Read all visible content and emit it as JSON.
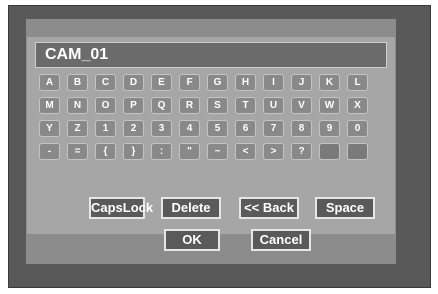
{
  "title": "CAM_01",
  "keyboard": {
    "rows": [
      [
        "A",
        "B",
        "C",
        "D",
        "E",
        "F",
        "G",
        "H",
        "I",
        "J",
        "K",
        "L"
      ],
      [
        "M",
        "N",
        "O",
        "P",
        "Q",
        "R",
        "S",
        "T",
        "U",
        "V",
        "W",
        "X"
      ],
      [
        "Y",
        "Z",
        "1",
        "2",
        "3",
        "4",
        "5",
        "6",
        "7",
        "8",
        "9",
        "0"
      ],
      [
        "-",
        "=",
        "{",
        "}",
        ":",
        "\"",
        "~",
        "<",
        ">",
        "?",
        "",
        ""
      ]
    ]
  },
  "actions": {
    "capslock": "CapsLock",
    "delete": "Delete",
    "back": "<< Back",
    "space": "Space"
  },
  "confirm": {
    "ok": "OK",
    "cancel": "Cancel"
  }
}
